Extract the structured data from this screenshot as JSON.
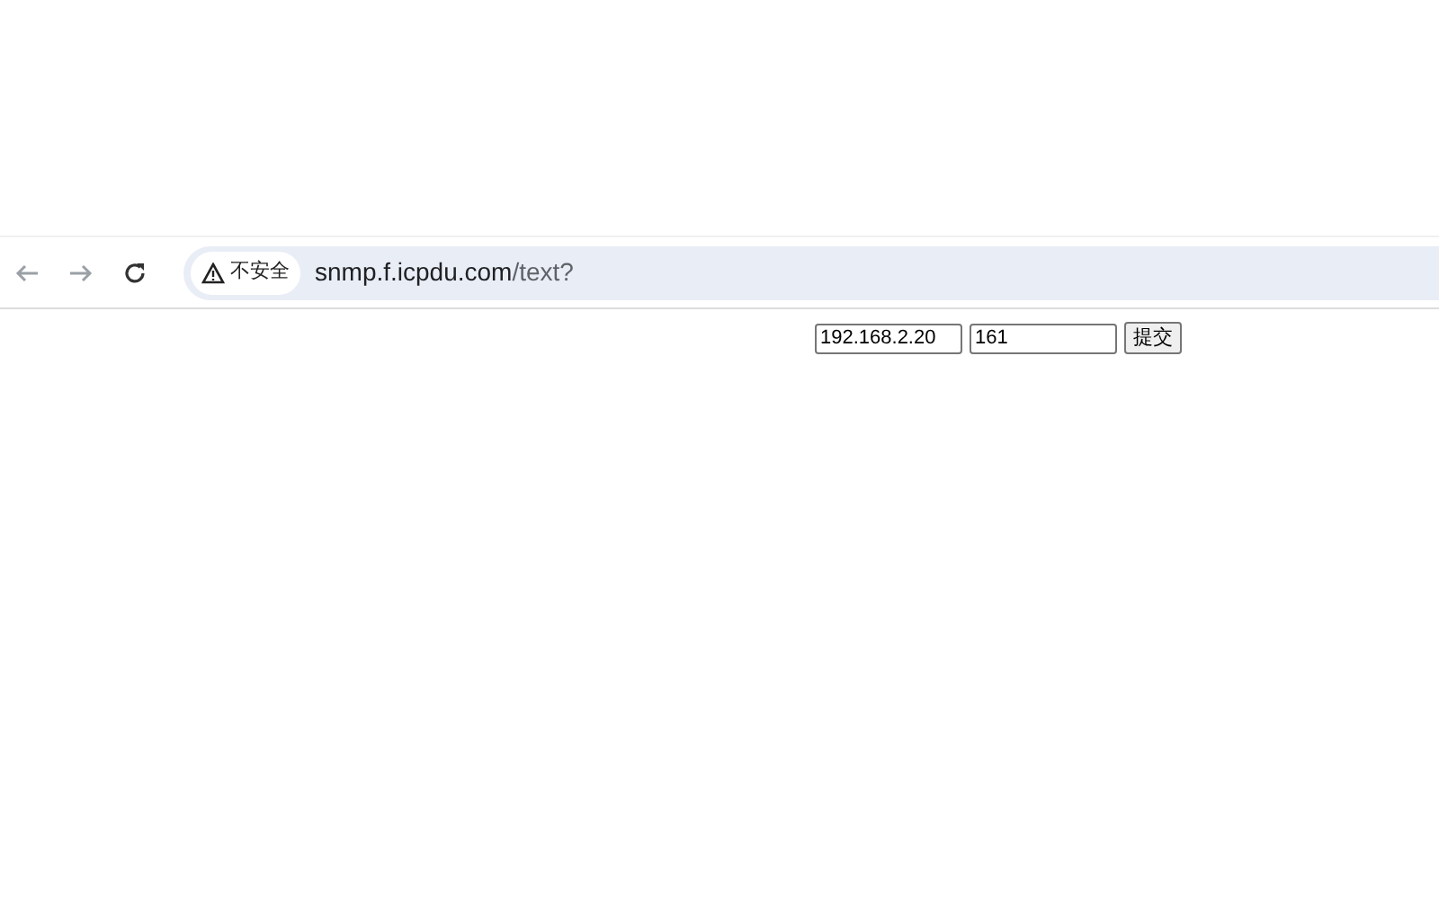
{
  "toolbar": {
    "back": {
      "disabled": true
    },
    "forward": {
      "disabled": true
    },
    "security_label": "不安全",
    "address": {
      "host": "snmp.f.icpdu.com",
      "path": "/text?"
    }
  },
  "form": {
    "fields": [
      {
        "value": "192.168.2.20"
      },
      {
        "value": "161"
      }
    ],
    "submit": "提交"
  }
}
